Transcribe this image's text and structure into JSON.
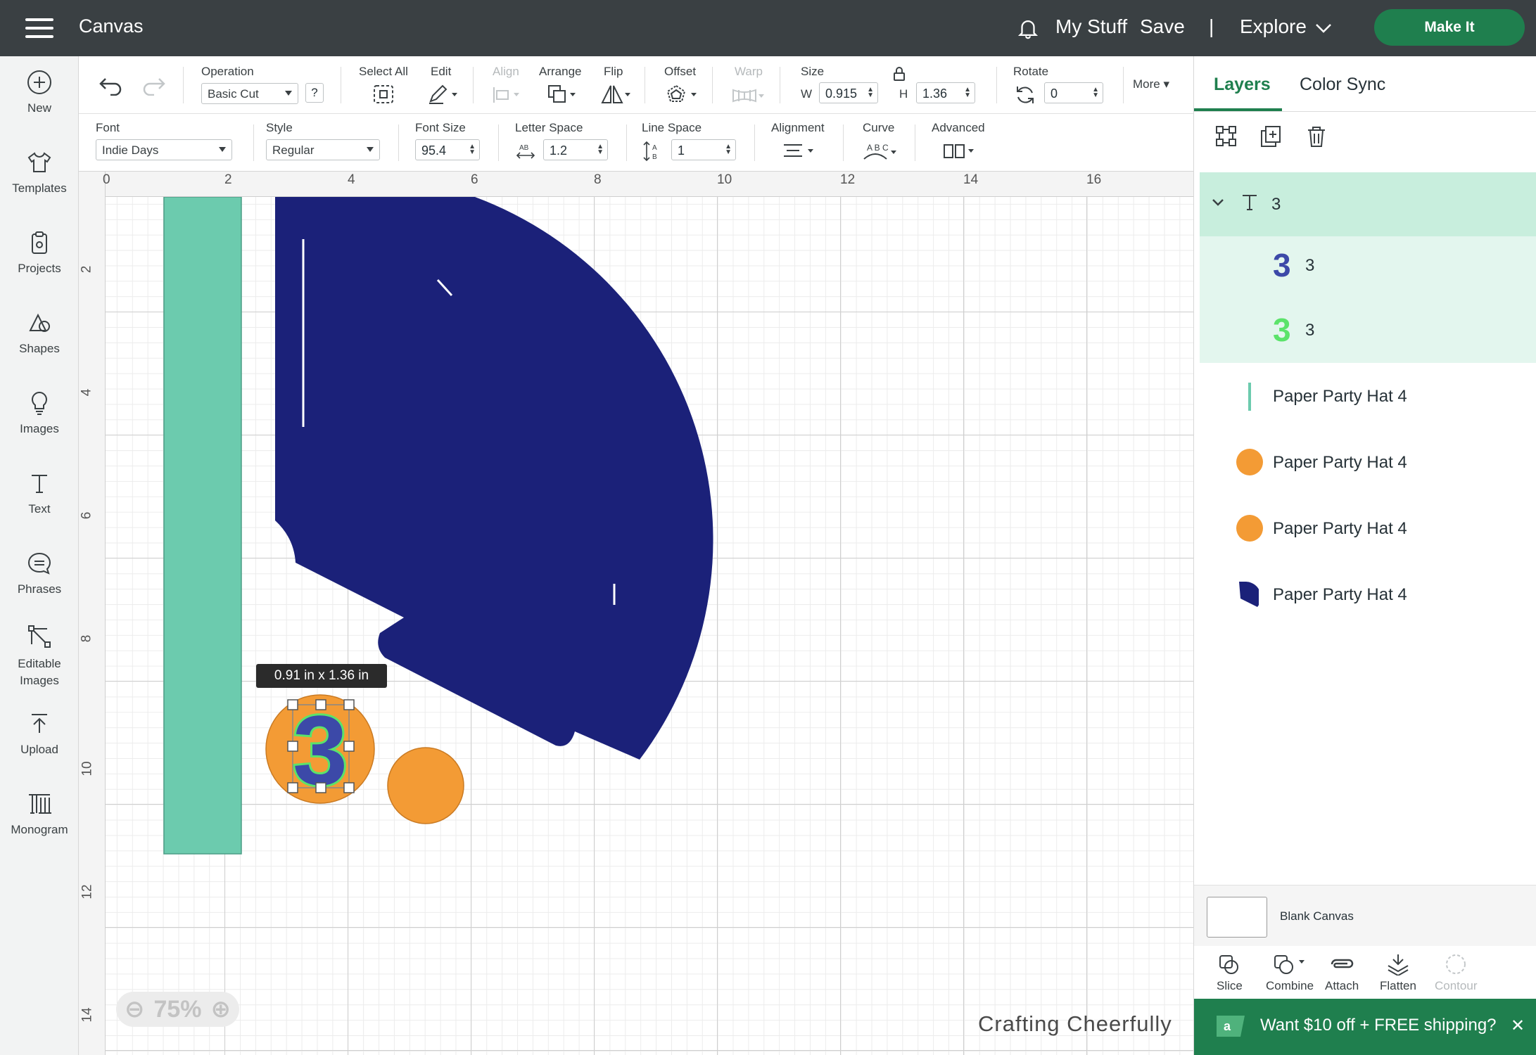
{
  "app": {
    "title": "Canvas"
  },
  "topbar": {
    "my_stuff": "My Stuff",
    "save": "Save",
    "separator": "|",
    "explore": "Explore",
    "make_it": "Make It"
  },
  "leftbar": [
    {
      "label": "New",
      "icon": "plus-circle-icon"
    },
    {
      "label": "Templates",
      "icon": "shirt-icon"
    },
    {
      "label": "Projects",
      "icon": "clipboard-icon"
    },
    {
      "label": "Shapes",
      "icon": "shapes-icon"
    },
    {
      "label": "Images",
      "icon": "lightbulb-icon"
    },
    {
      "label": "Text",
      "icon": "text-icon"
    },
    {
      "label": "Phrases",
      "icon": "speech-bubble-icon"
    },
    {
      "label": "Editable Images",
      "icon": "editable-images-icon"
    },
    {
      "label": "Upload",
      "icon": "upload-icon"
    },
    {
      "label": "Monogram",
      "icon": "monogram-icon"
    }
  ],
  "toolbar1": {
    "operation_label": "Operation",
    "operation_value": "Basic Cut",
    "help": "?",
    "select_all": "Select All",
    "edit": "Edit",
    "align": "Align",
    "arrange": "Arrange",
    "flip": "Flip",
    "offset": "Offset",
    "warp": "Warp",
    "size": "Size",
    "w_label": "W",
    "w_value": "0.915",
    "h_label": "H",
    "h_value": "1.36",
    "rotate": "Rotate",
    "rotate_value": "0",
    "more": "More"
  },
  "toolbar2": {
    "font_label": "Font",
    "font_value": "Indie Days",
    "style_label": "Style",
    "style_value": "Regular",
    "font_size_label": "Font Size",
    "font_size_value": "95.4",
    "letter_space_label": "Letter Space",
    "letter_space_value": "1.2",
    "line_space_label": "Line Space",
    "line_space_value": "1",
    "alignment_label": "Alignment",
    "curve_label": "Curve",
    "advanced_label": "Advanced"
  },
  "ruler": {
    "h": [
      "0",
      "2",
      "4",
      "6",
      "8",
      "10",
      "12",
      "14",
      "16"
    ],
    "v": [
      "2",
      "4",
      "6",
      "8",
      "10",
      "12",
      "14"
    ]
  },
  "canvas": {
    "size_tooltip": "0.91  in x 1.36  in",
    "zoom": "75%",
    "watermark": "Crafting Cheerfully"
  },
  "colors": {
    "teal": "#6ccbae",
    "navy": "#1b2179",
    "orange": "#f39b35",
    "green_accent": "#1f7f4e",
    "number_blue": "#3c49a8",
    "number_green": "#5be36a"
  },
  "layers": {
    "tab_layers": "Layers",
    "tab_color_sync": "Color Sync",
    "group": {
      "name": "3",
      "icon": "text-icon"
    },
    "children": [
      {
        "name": "3",
        "color": "#3c49a8"
      },
      {
        "name": "3",
        "color": "#5be36a"
      }
    ],
    "items": [
      {
        "name": "Paper Party Hat 4",
        "swatch": "line",
        "color": "#6ccbae"
      },
      {
        "name": "Paper Party Hat 4",
        "swatch": "circle",
        "color": "#f39b35"
      },
      {
        "name": "Paper Party Hat 4",
        "swatch": "circle",
        "color": "#f39b35"
      },
      {
        "name": "Paper Party Hat 4",
        "swatch": "hat",
        "color": "#1b2179"
      }
    ],
    "blank_canvas": "Blank Canvas",
    "actions": [
      {
        "label": "Slice",
        "enabled": true
      },
      {
        "label": "Combine",
        "enabled": true
      },
      {
        "label": "Attach",
        "enabled": true
      },
      {
        "label": "Flatten",
        "enabled": true
      },
      {
        "label": "Contour",
        "enabled": false
      }
    ],
    "promo": "Want $10 off + FREE shipping?",
    "promo_close": "✕"
  }
}
